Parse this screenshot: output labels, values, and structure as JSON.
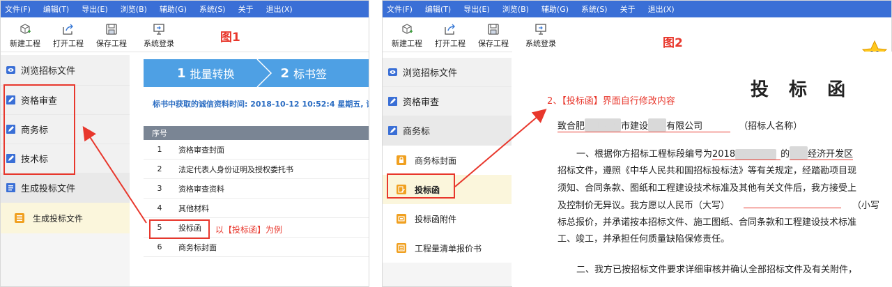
{
  "menu": [
    "文件(F)",
    "编辑(T)",
    "导出(E)",
    "浏览(B)",
    "辅助(G)",
    "系统(S)",
    "关于",
    "退出(X)"
  ],
  "toolbar": {
    "new": "新建工程",
    "open": "打开工程",
    "save": "保存工程",
    "login": "系统登录"
  },
  "fig1": {
    "label": "图1"
  },
  "fig2": {
    "label": "图2"
  },
  "sidebar1": {
    "browse": "浏览招标文件",
    "qualification": "资格审查",
    "business": "商务标",
    "technical": "技术标",
    "generate_group": "生成投标文件",
    "generate_item": "生成投标文件"
  },
  "steps": {
    "step1_num": "1",
    "step1": "批量转换",
    "step2_num": "2",
    "step2": "标书签"
  },
  "timeline": "标书中获取的诚信资料时间: 2018-10-12 10:52:4 星期五, 请",
  "table": {
    "header": "序号",
    "rows": [
      {
        "no": "1",
        "name": "资格审查封面"
      },
      {
        "no": "2",
        "name": "法定代表人身份证明及授权委托书"
      },
      {
        "no": "3",
        "name": "资格审查资料"
      },
      {
        "no": "4",
        "name": "其他材料"
      },
      {
        "no": "5",
        "name": "投标函"
      },
      {
        "no": "6",
        "name": "商务标封面"
      }
    ]
  },
  "note1": "以【投标函】为例",
  "sidebar2": {
    "browse": "浏览招标文件",
    "qualification": "资格审查",
    "business": "商务标",
    "sub": [
      "商务标封面",
      "投标函",
      "投标函附件",
      "工程量清单报价书"
    ]
  },
  "note2": "2、【投标函】界面自行修改内容",
  "doc": {
    "title": "投 标 函",
    "to_prefix": "致合肥",
    "to_mid": "市建设",
    "to_suffix": "有限公司",
    "to_label": "（招标人名称）",
    "p1_l1_a": "一、根据你方招标工程标段编号为",
    "p1_l1_b": "2018",
    "p1_l1_c": "的",
    "p1_l1_d": "经济开发区",
    "p1_l2": "招标文件，遵照《中华人民共和国招标投标法》等有关规定，经踏勘项目现",
    "p1_l3": "须知、合同条款、图纸和工程建设技术标准及其他有关文件后，我方接受上",
    "p1_l4_a": "及控制价无异议。我方愿以人民币（大写）",
    "p1_l4_b": "（小写",
    "p1_l5": "标总报价，并承诺按本招标文件、施工图纸、合同条款和工程建设技术标准",
    "p1_l6": "工、竣工，并承担任何质量缺陷保修责任。",
    "p2_l1": "二、我方已按招标文件要求详细审核并确认全部招标文件及有关附件，"
  }
}
